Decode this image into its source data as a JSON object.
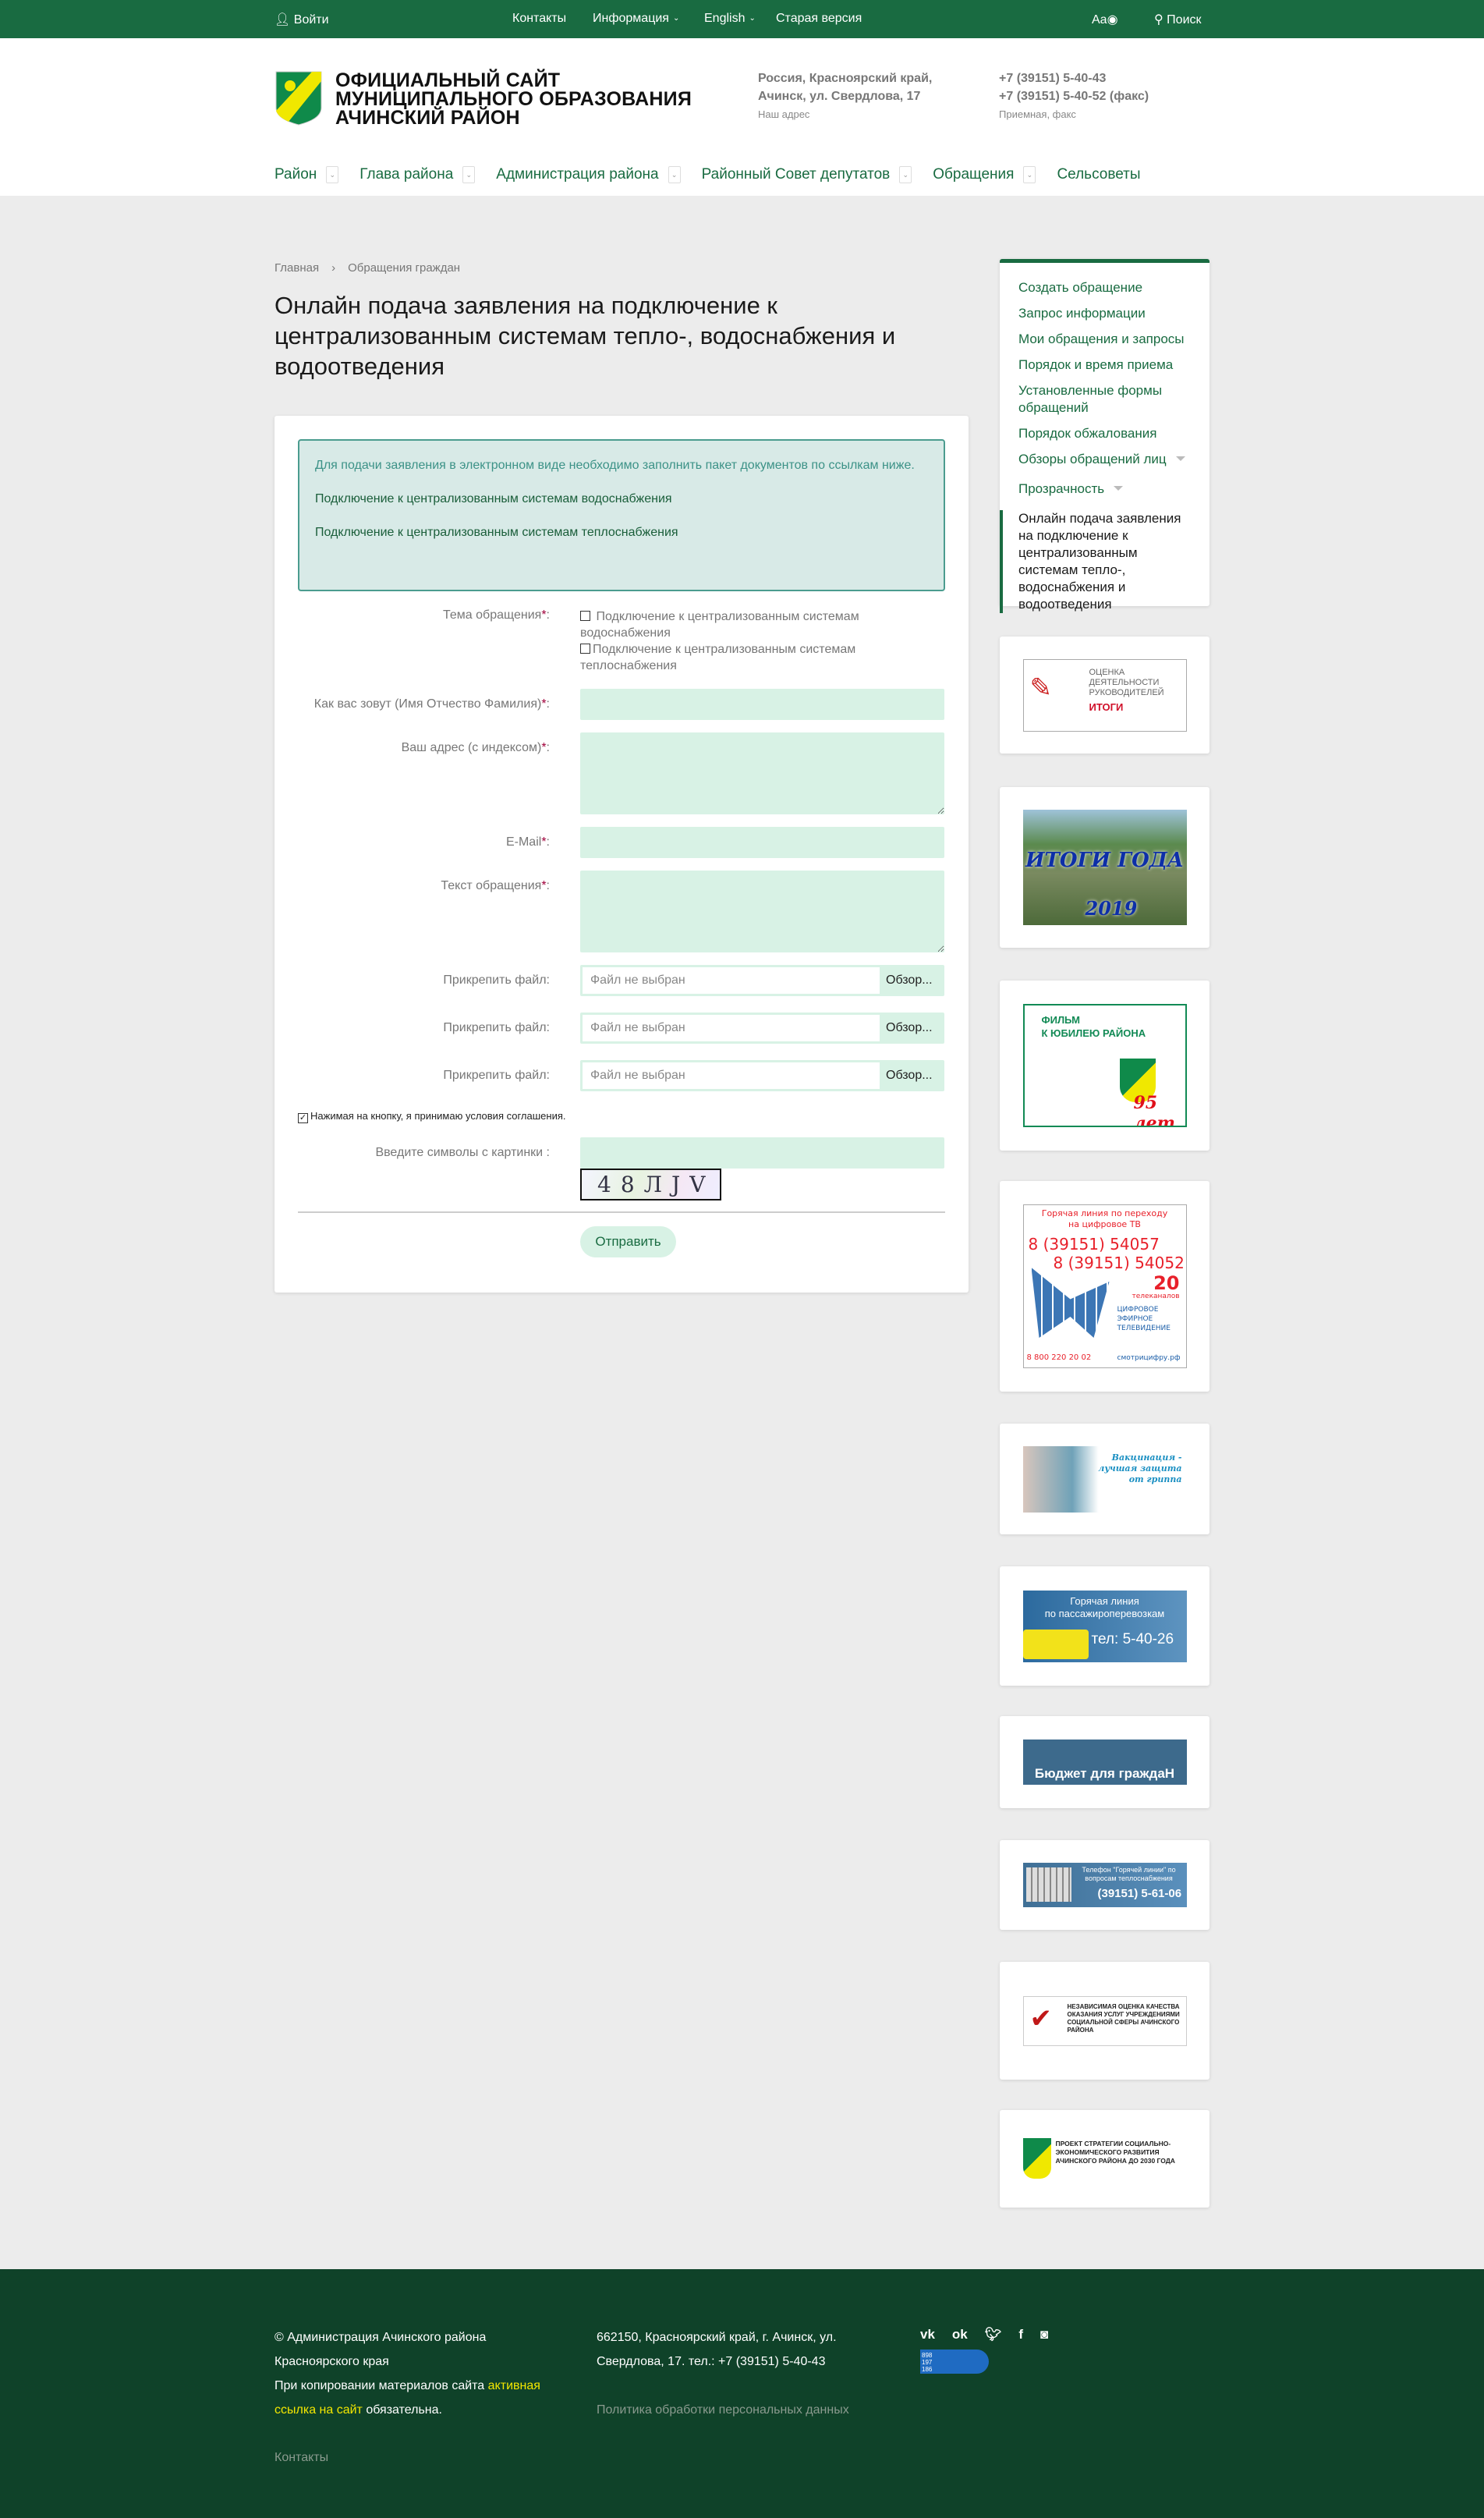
{
  "topbar": {
    "login": "Войти",
    "contacts": "Контакты",
    "info": "Информация",
    "lang": "English",
    "old": "Старая версия",
    "accessibility": "Aa",
    "search": "Поиск"
  },
  "header": {
    "title_lines": [
      "Официальный сайт",
      "муниципального образования",
      "Ачинский район"
    ],
    "address_lines": [
      "Россия, Красноярский край,",
      "Ачинск, ул. Свердлова, 17"
    ],
    "address_caption": "Наш адрес",
    "phones": [
      "+7 (39151) 5-40-43",
      "+7 (39151) 5-40-52 (факс)"
    ],
    "phones_caption": "Приемная, факс"
  },
  "nav": [
    {
      "label": "Район"
    },
    {
      "label": "Глава района"
    },
    {
      "label": "Администрация района"
    },
    {
      "label": "Районный Совет депутатов"
    },
    {
      "label": "Обращения"
    },
    {
      "label": "Сельсоветы"
    }
  ],
  "breadcrumb": {
    "home": "Главная",
    "sep": "›",
    "current": "Обращения граждан"
  },
  "page_title": "Онлайн подача заявления на подключение к централизованным системам тепло-, водоснабжения и водоотведения",
  "info": {
    "text": "Для подачи заявления в электронном виде необходимо заполнить пакет документов по ссылкам ниже.",
    "link1": "Подключение к централизованным системам водоснабжения",
    "link2": "Подключение к централизованным системам теплоснабжения"
  },
  "form": {
    "theme_label": "Тема обращения",
    "required": "*",
    "colon": ":",
    "theme_opt1": "Подключение к централизованным системам водоснабжения",
    "theme_opt2": "Подключение к централизованным системам теплоснабжения",
    "name_label": "Как вас зовут (Имя Отчество Фамилия)",
    "address_label": "Ваш адрес (с индексом)",
    "email_label": "E-Mail",
    "text_label": "Текст обращения",
    "file_label": "Прикрепить файл:",
    "file_none": "Файл не выбран",
    "browse": "Обзор...",
    "agree": "Нажимая на кнопку, я принимаю условия соглашения.",
    "agree_checked": true,
    "captcha_label": "Введите символы с картинки :",
    "captcha_text": "48ЛJV",
    "submit": "Отправить"
  },
  "sidebar": {
    "items": [
      {
        "label": "Создать обращение"
      },
      {
        "label": "Запрос информации"
      },
      {
        "label": "Мои обращения и запросы"
      },
      {
        "label": "Порядок и время приема"
      },
      {
        "label": "Установленные формы обращений"
      },
      {
        "label": "Порядок обжалования"
      },
      {
        "label": "Обзоры обращений лиц"
      },
      {
        "label": "Прозрачность"
      },
      {
        "label": "Онлайн подача заявления на подключение к централизованным системам тепло-, водоснабжения и водоотведения"
      }
    ]
  },
  "banners": {
    "b1": {
      "l1": "ОЦЕНКА",
      "l2": "ДЕЯТЕЛЬНОСТИ",
      "l3": "РУКОВОДИТЕЛЕЙ",
      "l4": "ИТОГИ"
    },
    "b2": {
      "l1": "ИТОГИ ГОДА",
      "l2": "2019"
    },
    "b3": {
      "l1": "ФИЛЬМ",
      "l2": "К ЮБИЛЕЮ РАЙОНА",
      "l3": "95 лет"
    },
    "b4": {
      "l1": "Горячая линия по переходу",
      "l2": "на цифровое ТВ",
      "l3": "8 (39151) 54057",
      "l4": "8 (39151) 54052",
      "l5": "20",
      "l6": "телеканалов",
      "l7": "ЦИФРОВОЕ ЭФИРНОЕ ТЕЛЕВИДЕНИЕ",
      "l8": "8 800 220 20 02",
      "l9": "смотрицифру.рф"
    },
    "b5": {
      "l1": "Вакцинация - лучшая защита от гриппа"
    },
    "b6": {
      "l1": "Горячая линия",
      "l2": "по пассажироперевозкам",
      "l3": "тел: 5-40-26"
    },
    "b7": {
      "l1": "Бюджет для граждаН"
    },
    "b8": {
      "l1": "Телефон \"Горячей линии\" по вопросам теплоснабжения",
      "l2": "(39151) 5-61-06"
    },
    "b9": {
      "l1": "НЕЗАВИСИМАЯ ОЦЕНКА КАЧЕСТВА ОКАЗАНИЯ УСЛУГ УЧРЕЖДЕНИЯМИ СОЦИАЛЬНОЙ СФЕРЫ АЧИНСКОГО РАЙОНА"
    },
    "b10": {
      "l1": "ПРОЕКТ СТРАТЕГИИ СОЦИАЛЬНО-ЭКОНОМИЧЕСКОГО РАЗВИТИЯ АЧИНСКОГО РАЙОНА ДО 2030 ГОДА"
    }
  },
  "footer": {
    "copy1": "© Администрация Ачинского района",
    "copy2": "Красноярского края",
    "copy3": "При копировании материалов сайта",
    "copy_link": "активная ссылка на сайт",
    "copy4": "обязательна.",
    "addr1": "662150, Красноярский край, г. Ачинск, ул.",
    "addr2": "Свердлова, 17. тел.: +7 (39151) 5-40-43",
    "policy": "Политика обработки персональных данных",
    "contacts": "Контакты",
    "social": [
      "vk",
      "ok",
      "twitter",
      "facebook",
      "instagram"
    ],
    "counter": [
      "898",
      "197",
      "186"
    ]
  },
  "colors": {
    "brand": "#196b41",
    "footer": "#0f4229",
    "input": "#d8f2e5",
    "accent_yellow": "#f3e600"
  }
}
